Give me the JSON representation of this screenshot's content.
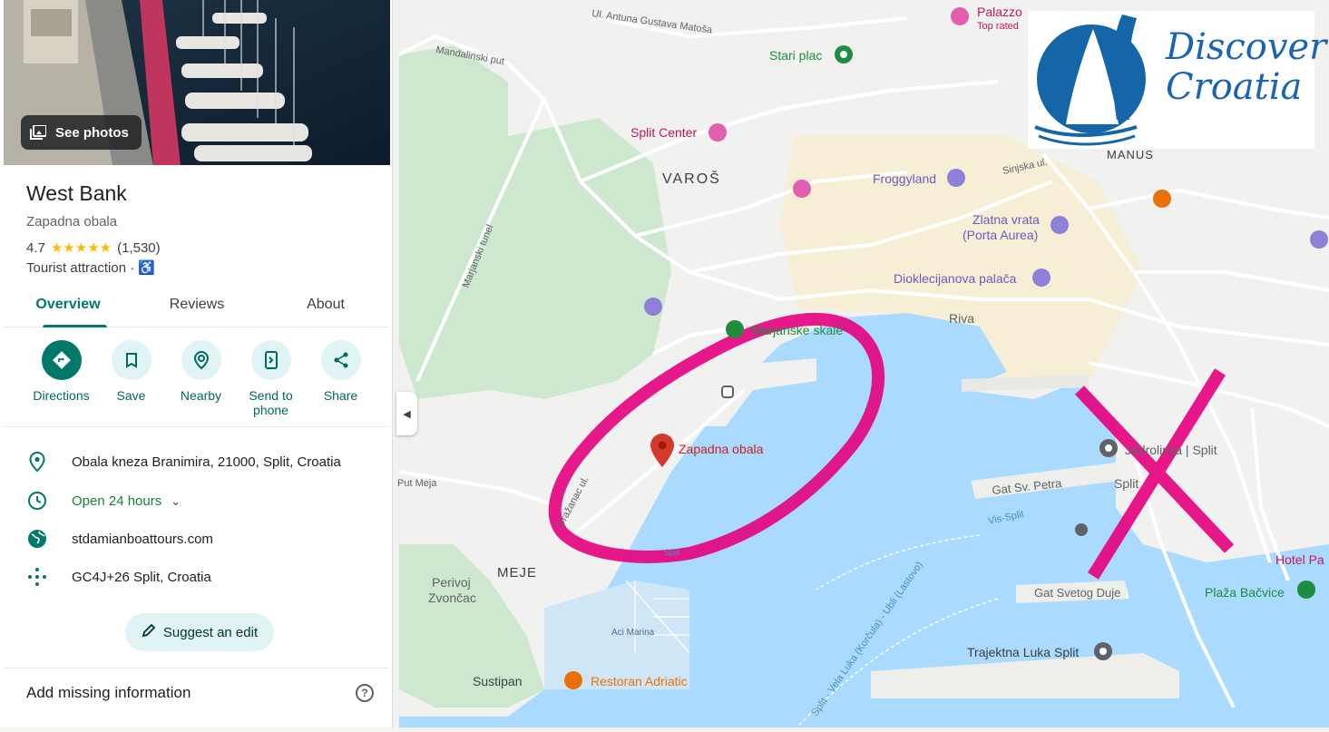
{
  "place": {
    "photos_label": "See photos",
    "title": "West Bank",
    "subtitle": "Zapadna obala",
    "rating": "4.7",
    "stars": "★★★★★",
    "reviews_count": "(1,530)",
    "category": "Tourist attraction ·"
  },
  "tabs": [
    {
      "label": "Overview",
      "active": true
    },
    {
      "label": "Reviews",
      "active": false
    },
    {
      "label": "About",
      "active": false
    }
  ],
  "actions": [
    {
      "label": "Directions",
      "icon": "directions-icon"
    },
    {
      "label": "Save",
      "icon": "bookmark-icon"
    },
    {
      "label": "Nearby",
      "icon": "nearby-icon"
    },
    {
      "label": "Send to phone",
      "icon": "send-to-phone-icon"
    },
    {
      "label": "Share",
      "icon": "share-icon"
    }
  ],
  "info": {
    "address": "Obala kneza Branimira, 21000, Split, Croatia",
    "hours": "Open 24 hours",
    "website": "stdamianboattours.com",
    "plus_code": "GC4J+26 Split, Croatia"
  },
  "suggest_edit": "Suggest an edit",
  "add_missing": "Add missing information",
  "help": "?",
  "logo": {
    "line1": "Discover",
    "line2": "Croatia"
  },
  "colors": {
    "accent": "#00796b",
    "water": "#aadaff",
    "park": "#c8e6c9",
    "annotation": "#e6007e"
  },
  "map_labels": {
    "palazzo": "Palazzo",
    "top_rated": "Top rated",
    "antuna": "Ul. Antuna Gustava Matoša",
    "mandalinski": "Mandalinski put",
    "stari_plac": "Stari plac",
    "split_center": "Split Center",
    "varos": "VAROŠ",
    "froggyland": "Froggyland",
    "sinjska": "Sinjska ul.",
    "manus": "MANUS",
    "zlatna_vrata_1": "Zlatna vrata",
    "zlatna_vrata_2": "(Porta Aurea)",
    "dioklecijanova": "Dioklecijanova palača",
    "riva": "Riva",
    "marjanski_tunel": "Marjanski tunel",
    "marjanske_skale": "Marjanske skale",
    "zapadna_obala": "Zapadna obala",
    "put_meja": "Put Meja",
    "drazanac": "Dražanac ul.",
    "jadrolinija": "Jadrolinija | Split",
    "split": "Split",
    "gat_sv_petra": "Gat Sv. Petra",
    "vis_split": "Vis-Split",
    "split_small": "Split",
    "meje": "MEJE",
    "perivoj_1": "Perivoj",
    "perivoj_2": "Zvončac",
    "aci_marina": "Aci Marina",
    "gat_svetog_duje": "Gat Svetog Duje",
    "ferry_route": "Split - Vela Luka (Korčula) - Ubli (Lastovo)",
    "hotel_pa": "Hotel Pa",
    "plaza_bacvice": "Plaža Bačvice",
    "trajektna": "Trajektna Luka Split",
    "sustipan": "Sustipan",
    "restoran": "Restoran Adriatic"
  }
}
